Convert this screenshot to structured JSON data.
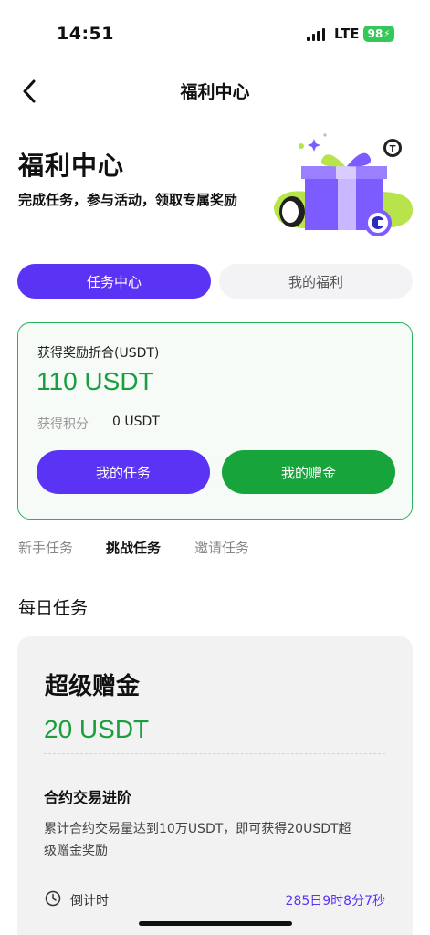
{
  "status_bar": {
    "time": "14:51",
    "network": "LTE",
    "battery": "98"
  },
  "nav": {
    "title": "福利中心",
    "back_icon": "chevron-left-icon"
  },
  "hero": {
    "title": "福利中心",
    "subtitle": "完成任务，参与活动，领取专属奖励",
    "art_icon": "gift-box-illustration"
  },
  "segments": {
    "active": "任务中心",
    "inactive": "我的福利"
  },
  "reward_card": {
    "label": "获得奖励折合(USDT)",
    "value": "110 USDT",
    "points_label": "获得积分",
    "points_value": "0 USDT",
    "my_tasks_button": "我的任务",
    "my_bonus_button": "我的赠金"
  },
  "categories": {
    "newbie": "新手任务",
    "challenge": "挑战任务",
    "invite": "邀请任务"
  },
  "section": {
    "daily_title": "每日任务"
  },
  "task_card": {
    "title": "超级赠金",
    "reward": "20 USDT",
    "subtitle": "合约交易进阶",
    "description": "累计合约交易量达到10万USDT，即可获得20USDT超级赠金奖励",
    "countdown_label": "倒计时",
    "countdown_value": "285日9时8分7秒",
    "clock_icon": "clock-icon"
  },
  "colors": {
    "brand_purple": "#5b33f5",
    "brand_green": "#17a43a",
    "value_green": "#1a9e3e"
  }
}
